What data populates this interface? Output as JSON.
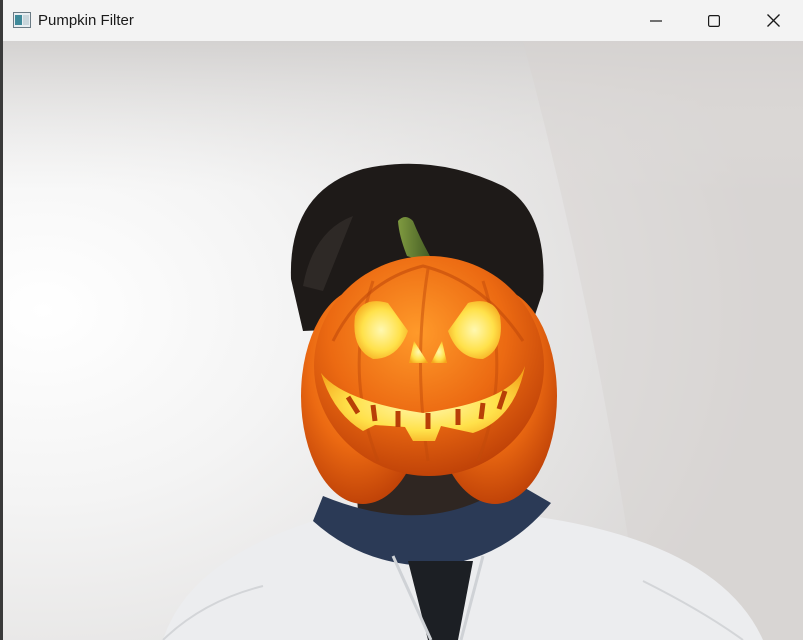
{
  "window": {
    "title": "Pumpkin Filter",
    "icon": "app-window-icon"
  },
  "controls": {
    "minimize": "minimize-icon",
    "maximize": "maximize-icon",
    "close": "close-icon"
  },
  "video": {
    "content": "webcam-frame-with-pumpkin-overlay",
    "overlay": "jack-o-lantern-icon"
  },
  "colors": {
    "titlebar": "#f3f3f3",
    "pumpkin": "#e8620f",
    "pumpkin_glow": "#ffe14a",
    "stem": "#5f7a2e"
  }
}
